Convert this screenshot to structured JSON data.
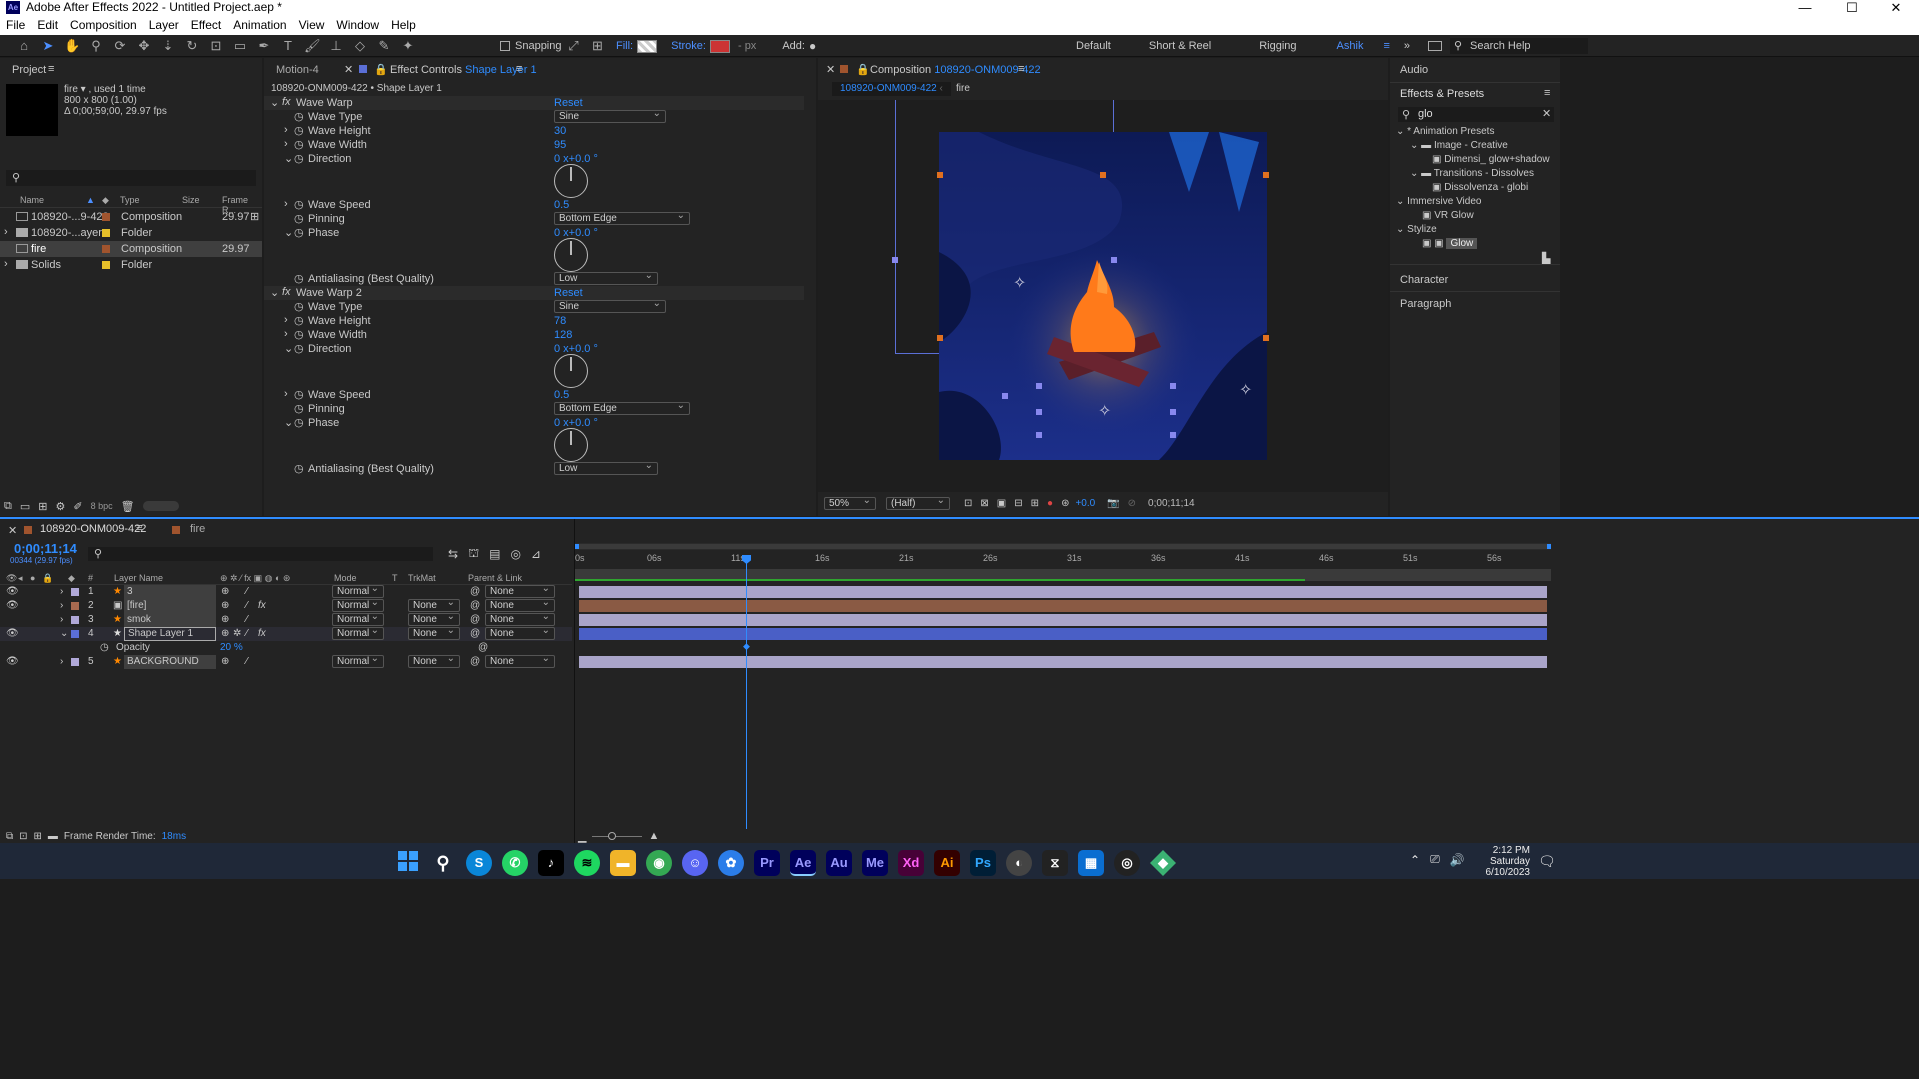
{
  "window": {
    "title": "Adobe After Effects 2022 - Untitled Project.aep *",
    "app_icon": "Ae"
  },
  "menu": [
    "File",
    "Edit",
    "Composition",
    "Layer",
    "Effect",
    "Animation",
    "View",
    "Window",
    "Help"
  ],
  "toolbar": {
    "snapping": "Snapping",
    "fill": "Fill:",
    "stroke": "Stroke:",
    "px": "- px",
    "add": "Add:"
  },
  "workspaces": [
    "Default",
    "Short & Reel",
    "Rigging",
    "Ashik"
  ],
  "search_help": "Search Help",
  "project": {
    "tab": "Project",
    "item_name": "fire ▾ , used 1 time",
    "item_size": "800 x 800 (1.00)",
    "item_dur": "Δ 0;00;59;00, 29.97 fps",
    "cols": [
      "Name",
      "Type",
      "Size",
      "Frame R..."
    ],
    "items": [
      {
        "name": "108920-...9-422",
        "type": "Composition",
        "fps": "29.97",
        "color": "#a0542e"
      },
      {
        "name": "108920-...ayers",
        "type": "Folder",
        "fps": "",
        "color": "#e6c02a"
      },
      {
        "name": "fire",
        "type": "Composition",
        "fps": "29.97",
        "color": "#a0542e"
      },
      {
        "name": "Solids",
        "type": "Folder",
        "fps": "",
        "color": "#e6c02a"
      }
    ],
    "bpc": "8 bpc"
  },
  "effect_controls": {
    "tab_motion": "Motion-4",
    "tab_label": "Effect Controls",
    "tab_layer": "Shape Layer 1",
    "path": "108920-ONM009-422 • Shape Layer 1",
    "effects": [
      {
        "name": "Wave Warp",
        "reset": "Reset",
        "wave_type": "Sine",
        "height": "30",
        "width": "95",
        "direction": "0 x+0.0 °",
        "speed": "0.5",
        "pinning": "Bottom Edge",
        "phase": "0 x+0.0 °",
        "aa": "Low"
      },
      {
        "name": "Wave Warp 2",
        "reset": "Reset",
        "wave_type": "Sine",
        "height": "78",
        "width": "128",
        "direction": "0 x+0.0 °",
        "speed": "0.5",
        "pinning": "Bottom Edge",
        "phase": "0 x+0.0 °",
        "aa": "Low"
      }
    ],
    "labels": {
      "wave_type": "Wave Type",
      "height": "Wave Height",
      "width": "Wave Width",
      "direction": "Direction",
      "speed": "Wave Speed",
      "pinning": "Pinning",
      "phase": "Phase",
      "aa": "Antialiasing (Best Quality)"
    }
  },
  "composition": {
    "tab_label": "Composition",
    "tab_name": "108920-ONM009-422",
    "crumb1": "108920-ONM009-422",
    "crumb2": "fire",
    "zoom": "50%",
    "res": "(Half)",
    "exposure": "+0.0",
    "timecode": "0;00;11;14"
  },
  "right": {
    "audio": "Audio",
    "effects_presets": "Effects & Presets",
    "search": "glo",
    "tree": [
      {
        "label": "* Animation Presets",
        "depth": 0
      },
      {
        "label": "Image - Creative",
        "depth": 1
      },
      {
        "label": "Dimensi_ glow+shadow",
        "depth": 2
      },
      {
        "label": "Transitions - Dissolves",
        "depth": 1
      },
      {
        "label": "Dissolvenza - globi",
        "depth": 2
      },
      {
        "label": "Immersive Video",
        "depth": 0
      },
      {
        "label": "VR Glow",
        "depth": 2
      },
      {
        "label": "Stylize",
        "depth": 0
      },
      {
        "label": "Glow",
        "depth": 2
      }
    ],
    "character": "Character",
    "paragraph": "Paragraph"
  },
  "timeline": {
    "tab1": "108920-ONM009-422",
    "tab2": "fire",
    "timecode": "0;00;11;14",
    "frames": "00344 (29.97 fps)",
    "col_headers": {
      "layer": "Layer Name",
      "mode": "Mode",
      "t": "T",
      "trkmat": "TrkMat",
      "parent": "Parent & Link"
    },
    "ruler": [
      "0s",
      "06s",
      "11s",
      "16s",
      "21s",
      "26s",
      "31s",
      "36s",
      "41s",
      "46s",
      "51s",
      "56s"
    ],
    "layers": [
      {
        "num": "1",
        "name": "3",
        "mode": "Normal",
        "trkmat": "",
        "parent": "None",
        "color": "#b0a8d8"
      },
      {
        "num": "2",
        "name": "[fire]",
        "mode": "Normal",
        "trkmat": "None",
        "parent": "None",
        "color": "#a86a50"
      },
      {
        "num": "3",
        "name": "smok",
        "mode": "Normal",
        "trkmat": "None",
        "parent": "None",
        "color": "#b0a8d8"
      },
      {
        "num": "4",
        "name": "Shape Layer 1",
        "mode": "Normal",
        "trkmat": "None",
        "parent": "None",
        "color": "#5b6fd6"
      },
      {
        "num": "5",
        "name": "BACKGROUND",
        "mode": "Normal",
        "trkmat": "None",
        "parent": "None",
        "color": "#b0a8d8"
      }
    ],
    "opacity_label": "Opacity",
    "opacity_value": "20 %",
    "render_time_label": "Frame Render Time:",
    "render_time": "18ms"
  },
  "taskbar": {
    "time": "2:12 PM",
    "day": "Saturday",
    "date": "6/10/2023"
  }
}
